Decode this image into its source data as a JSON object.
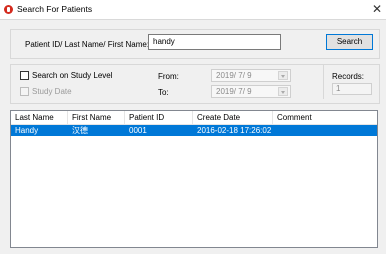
{
  "window": {
    "title": "Search For Patients"
  },
  "search": {
    "label": "Patient ID/ Last Name/ First Name:",
    "value": "handy",
    "button_label": "Search"
  },
  "filters": {
    "study_level_label": "Search on Study Level",
    "study_level_checked": false,
    "study_date_label": "Study Date",
    "study_date_checked": false,
    "from_label": "From:",
    "from_value": "2019/ 7/ 9",
    "to_label": "To:",
    "to_value": "2019/ 7/ 9"
  },
  "records": {
    "label": "Records:",
    "value": "1"
  },
  "table": {
    "columns": [
      "Last Name",
      "First Name",
      "Patient ID",
      "Create Date",
      "Comment"
    ],
    "rows": [
      {
        "last_name": "Handy",
        "first_name": "汉德",
        "patient_id": "0001",
        "create_date": "2016-02-18 17:26:02",
        "comment": "",
        "selected": true
      }
    ]
  },
  "colors": {
    "selection": "#0078d7",
    "app_icon": "#d42b1e"
  },
  "icons": {
    "app": "app-logo-icon",
    "close": "close-icon",
    "date_dropdown": "calendar-dropdown-icon"
  }
}
